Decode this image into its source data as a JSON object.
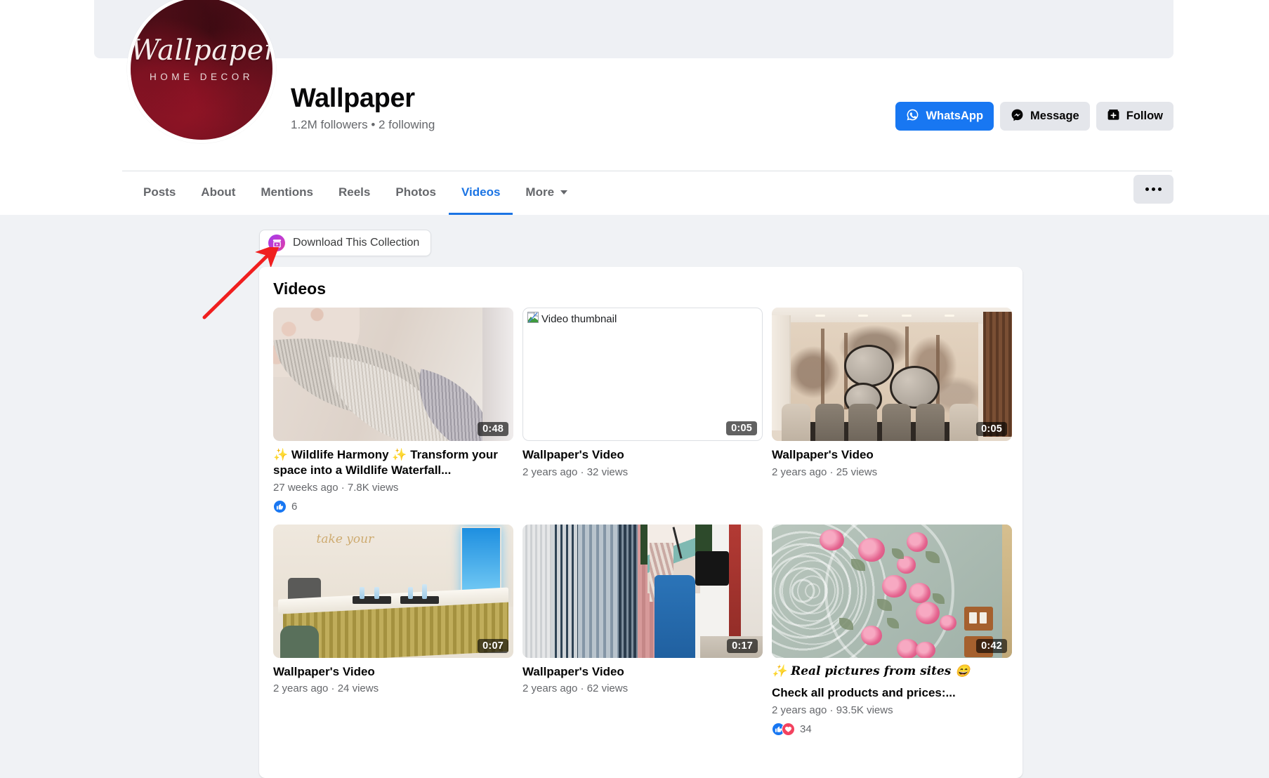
{
  "profile": {
    "name": "Wallpaper",
    "stats": "1.2M followers • 2 following",
    "avatar_script": "Wallpaper",
    "avatar_subtitle": "HOME DECOR"
  },
  "actions": {
    "whatsapp": "WhatsApp",
    "message": "Message",
    "follow": "Follow",
    "more_options": "..."
  },
  "tabs": [
    {
      "label": "Posts",
      "active": false
    },
    {
      "label": "About",
      "active": false
    },
    {
      "label": "Mentions",
      "active": false
    },
    {
      "label": "Reels",
      "active": false
    },
    {
      "label": "Photos",
      "active": false
    },
    {
      "label": "Videos",
      "active": true
    },
    {
      "label": "More",
      "active": false,
      "has_caret": true
    }
  ],
  "download": {
    "label": "Download This Collection"
  },
  "videos_section": {
    "heading": "Videos"
  },
  "videos": [
    {
      "title": "✨ Wildlife Harmony ✨ Transform your space into a Wildlife Waterfall...",
      "meta": "27 weeks ago · 7.8K views",
      "duration": "0:48",
      "reactions": [
        "like"
      ],
      "reaction_count": "6",
      "broken": false,
      "alt": ""
    },
    {
      "title": "Wallpaper's Video",
      "meta": "2 years ago · 32 views",
      "duration": "0:05",
      "reactions": [],
      "reaction_count": "",
      "broken": true,
      "alt": "Video thumbnail"
    },
    {
      "title": "Wallpaper's Video",
      "meta": "2 years ago · 25 views",
      "duration": "0:05",
      "reactions": [],
      "reaction_count": "",
      "broken": false,
      "alt": ""
    },
    {
      "title": "Wallpaper's Video",
      "meta": "2 years ago · 24 views",
      "duration": "0:07",
      "reactions": [],
      "reaction_count": "",
      "broken": false,
      "alt": ""
    },
    {
      "title": "Wallpaper's Video",
      "meta": "2 years ago · 62 views",
      "duration": "0:17",
      "reactions": [],
      "reaction_count": "",
      "broken": false,
      "alt": ""
    },
    {
      "title_line1": "✨ Real pictures from sites 😄",
      "title_line2": "Check all products and prices:...",
      "meta": "2 years ago · 93.5K views",
      "duration": "0:42",
      "reactions": [
        "like",
        "love"
      ],
      "reaction_count": "34",
      "broken": false,
      "alt": ""
    }
  ],
  "colors": {
    "accent_blue": "#1877f2",
    "tab_active": "#1b74e4",
    "page_bg": "#f0f2f5",
    "secondary_btn": "#e4e6eb",
    "annotation_red": "#f01f1f",
    "like_blue": "#1877f2",
    "love_red": "#f3425f"
  }
}
